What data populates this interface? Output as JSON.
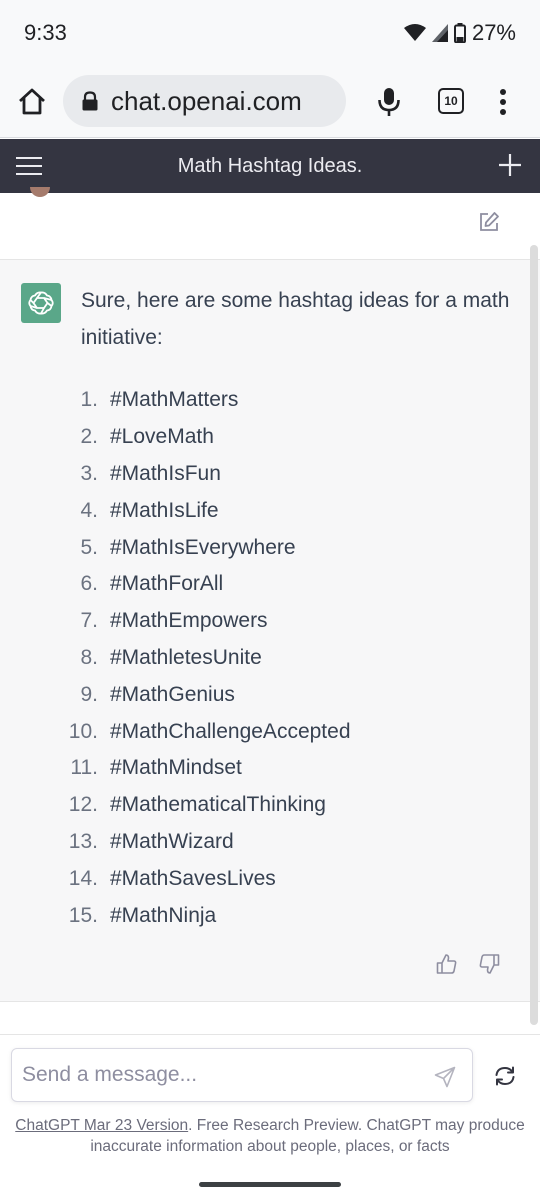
{
  "status": {
    "time": "9:33",
    "battery": "27%"
  },
  "browser": {
    "url": "chat.openai.com",
    "tab_count": "10"
  },
  "header": {
    "title": "Math Hashtag Ideas."
  },
  "assistant": {
    "intro": "Sure, here are some hashtag ideas for a math initiative:",
    "hashtags": [
      {
        "num": "1.",
        "tag": "#MathMatters"
      },
      {
        "num": "2.",
        "tag": "#LoveMath"
      },
      {
        "num": "3.",
        "tag": "#MathIsFun"
      },
      {
        "num": "4.",
        "tag": "#MathIsLife"
      },
      {
        "num": "5.",
        "tag": "#MathIsEverywhere"
      },
      {
        "num": "6.",
        "tag": "#MathForAll"
      },
      {
        "num": "7.",
        "tag": "#MathEmpowers"
      },
      {
        "num": "8.",
        "tag": "#MathletesUnite"
      },
      {
        "num": "9.",
        "tag": "#MathGenius"
      },
      {
        "num": "10.",
        "tag": "#MathChallengeAccepted"
      },
      {
        "num": "11.",
        "tag": "#MathMindset"
      },
      {
        "num": "12.",
        "tag": "#MathematicalThinking"
      },
      {
        "num": "13.",
        "tag": "#MathWizard"
      },
      {
        "num": "14.",
        "tag": "#MathSavesLives"
      },
      {
        "num": "15.",
        "tag": "#MathNinja"
      }
    ]
  },
  "input": {
    "placeholder": "Send a message..."
  },
  "footer": {
    "link_text": "ChatGPT Mar 23 Version",
    "text": ". Free Research Preview. ChatGPT may produce inaccurate information about people, places, or facts"
  },
  "colors": {
    "header_bg": "#343541",
    "assistant_bg": "#f7f7f8",
    "avatar_green": "#5aa789"
  }
}
